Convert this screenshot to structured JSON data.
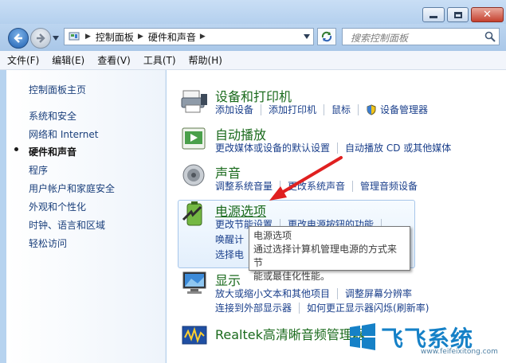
{
  "address": {
    "crumbs": [
      "控制面板",
      "硬件和声音"
    ]
  },
  "search": {
    "placeholder": "搜索控制面板"
  },
  "menu": [
    "文件(F)",
    "编辑(E)",
    "查看(V)",
    "工具(T)",
    "帮助(H)"
  ],
  "sidebar": {
    "items": [
      {
        "label": "控制面板主页"
      },
      {
        "label": "系统和安全"
      },
      {
        "label": "网络和 Internet"
      },
      {
        "label": "硬件和声音",
        "active": true
      },
      {
        "label": "程序"
      },
      {
        "label": "用户帐户和家庭安全"
      },
      {
        "label": "外观和个性化"
      },
      {
        "label": "时钟、语言和区域"
      },
      {
        "label": "轻松访问"
      }
    ]
  },
  "categories": {
    "devices": {
      "title": "设备和打印机",
      "links": [
        "添加设备",
        "添加打印机",
        "鼠标",
        "设备管理器"
      ],
      "icon": "printer-icon"
    },
    "autoplay": {
      "title": "自动播放",
      "links": [
        "更改媒体或设备的默认设置",
        "自动播放 CD 或其他媒体"
      ],
      "icon": "autoplay-icon"
    },
    "sound": {
      "title": "声音",
      "links": [
        "调整系统音量",
        "更改系统声音",
        "管理音频设备"
      ],
      "icon": "speaker-icon"
    },
    "power": {
      "title": "电源选项",
      "row1": [
        "更改节能设置",
        "更改电源按钮的功能"
      ],
      "row2a": "唤醒计",
      "row3a": "选择电",
      "icon": "battery-icon"
    },
    "display": {
      "title": "显示",
      "row1": [
        "放大或缩小文本和其他项目",
        "调整屏幕分辨率"
      ],
      "row2": [
        "连接到外部显示器",
        "如何更正显示器闪烁(刷新率)"
      ],
      "icon": "monitor-icon"
    },
    "realtek": {
      "title": "Realtek高清晰音频管理器",
      "icon": "audio-manager-icon"
    }
  },
  "tooltip": {
    "title": "电源选项",
    "line1": "通过选择计算机管理电源的方式来节",
    "line2": "能或最佳化性能。"
  },
  "watermark": {
    "brand": "飞飞系统",
    "url": "www.feifeixitong.com"
  },
  "colors": {
    "link": "#1a3f8b",
    "title": "#1a6a1c",
    "arrow": "#e02020",
    "watermark": "#1681c7"
  }
}
